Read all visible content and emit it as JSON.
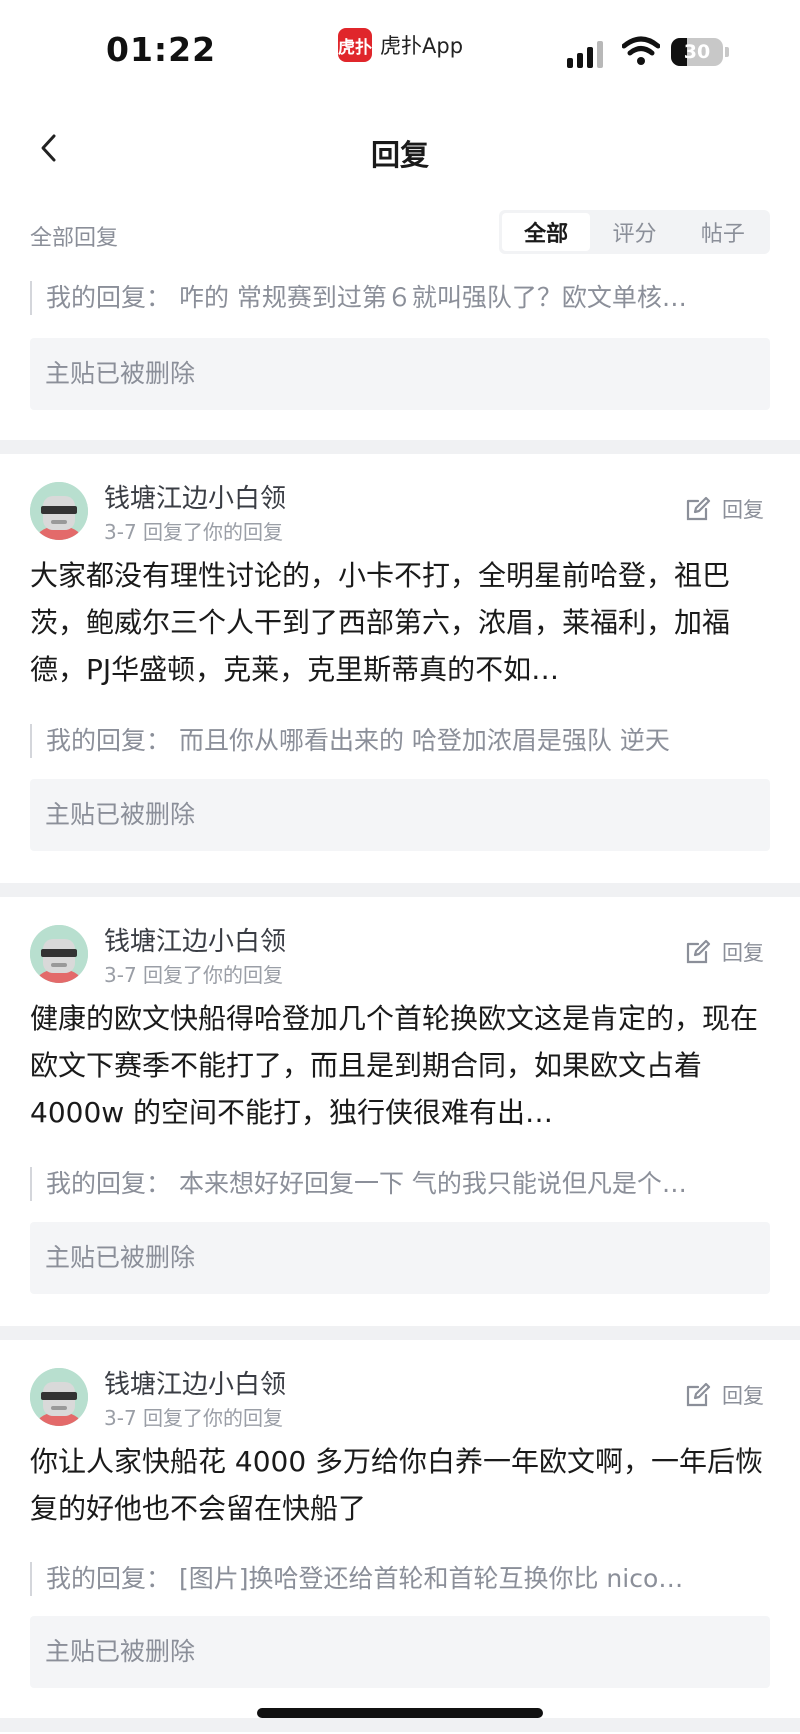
{
  "status_bar": {
    "time": "01:22",
    "app_logo_text": "虎扑",
    "app_name": "虎扑App",
    "battery_level": "30",
    "battery_fraction": 0.3
  },
  "nav": {
    "title": "回复",
    "back_icon": "chevron-left-icon"
  },
  "filter": {
    "label": "全部回复",
    "tabs": [
      "全部",
      "评分",
      "帖子"
    ],
    "active_tab": 0
  },
  "top_partial": {
    "my_reply_label": "我的回复：",
    "my_reply_text": "咋的 常规赛到过第６就叫强队了？欧文单核…",
    "deleted_text": "主贴已被删除"
  },
  "cards": [
    {
      "username": "钱塘江边小白领",
      "meta": "3-7 回复了你的回复",
      "reply_label": "回复",
      "content": "大家都没有理性讨论的，小卡不打，全明星前哈登，祖巴茨，鲍威尔三个人干到了西部第六，浓眉，莱福利，加福德，PJ华盛顿，克莱，克里斯蒂真的不如…",
      "my_reply_label": "我的回复：",
      "my_reply_text": "而且你从哪看出来的 哈登加浓眉是强队 逆天",
      "deleted_text": "主贴已被删除"
    },
    {
      "username": "钱塘江边小白领",
      "meta": "3-7 回复了你的回复",
      "reply_label": "回复",
      "content": "健康的欧文快船得哈登加几个首轮换欧文这是肯定的，现在欧文下赛季不能打了，而且是到期合同，如果欧文占着 4000w 的空间不能打，独行侠很难有出…",
      "my_reply_label": "我的回复：",
      "my_reply_text": "本来想好好回复一下 气的我只能说但凡是个…",
      "deleted_text": "主贴已被删除"
    },
    {
      "username": "钱塘江边小白领",
      "meta": "3-7 回复了你的回复",
      "reply_label": "回复",
      "content": "你让人家快船花 4000 多万给你白养一年欧文啊，一年后恢复的好他也不会留在快船了",
      "my_reply_label": "我的回复：",
      "my_reply_text": "[图片]换哈登还给首轮和首轮互换你比 nico…",
      "deleted_text": "主贴已被删除"
    }
  ],
  "colors": {
    "app_red": "#e0262b",
    "text_primary": "#1a1a1a",
    "text_secondary": "#8b8f99",
    "divider": "#f0f1f3",
    "avatar_bg": "#b8dfcf"
  }
}
